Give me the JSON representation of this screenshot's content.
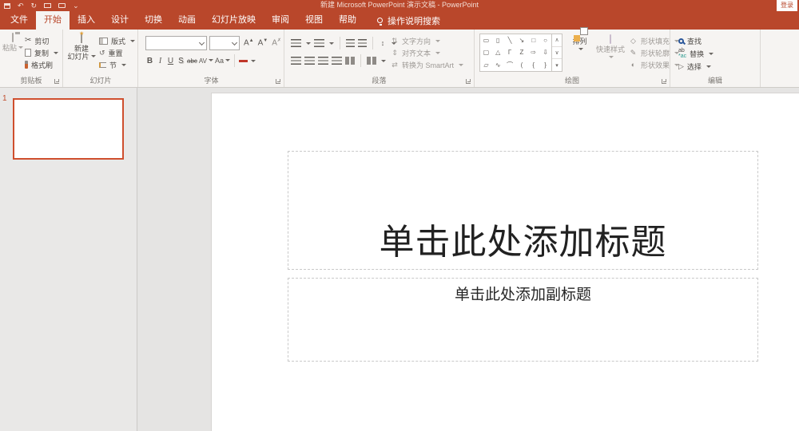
{
  "titlebar": {
    "title": "新建 Microsoft PowerPoint 演示文稿 - PowerPoint",
    "sign_in": "登录"
  },
  "tabs": {
    "items": [
      {
        "label": "文件"
      },
      {
        "label": "开始",
        "active": true
      },
      {
        "label": "插入"
      },
      {
        "label": "设计"
      },
      {
        "label": "切换"
      },
      {
        "label": "动画"
      },
      {
        "label": "幻灯片放映"
      },
      {
        "label": "审阅"
      },
      {
        "label": "视图"
      },
      {
        "label": "帮助"
      }
    ],
    "tell_me": "操作说明搜索"
  },
  "ribbon": {
    "clipboard": {
      "label": "剪贴板",
      "paste": "粘贴",
      "cut": "剪切",
      "copy": "复制",
      "format_painter": "格式刷"
    },
    "slides": {
      "label": "幻灯片",
      "new_slide_line1": "新建",
      "new_slide_line2": "幻灯片",
      "layout": "版式",
      "reset": "重置",
      "section": "节"
    },
    "font": {
      "label": "字体",
      "bold": "B",
      "italic": "I",
      "underline": "U",
      "shadow": "S",
      "strikethrough": "abc",
      "char_spacing": "AV",
      "change_case": "Aa",
      "font_color": "A",
      "grow_font": "A",
      "shrink_font": "A",
      "clear_format": "A"
    },
    "paragraph": {
      "label": "段落",
      "text_direction": "文字方向",
      "align_text": "对齐文本",
      "smartart": "转换为 SmartArt"
    },
    "drawing": {
      "label": "绘图",
      "arrange": "排列",
      "quick_styles": "快速样式",
      "shape_fill": "形状填充",
      "shape_outline": "形状轮廓",
      "shape_effects": "形状效果",
      "shapes": [
        "▭",
        "▯",
        "╲",
        "↘",
        "□",
        "○",
        "▢",
        "△",
        "Γ",
        "Z",
        "⇨",
        "⇩",
        "▱",
        "∿",
        "⌒",
        "(",
        "{",
        "}"
      ],
      "scroll": [
        "∧",
        "∨",
        "▾"
      ]
    },
    "editing": {
      "label": "编辑",
      "find": "查找",
      "replace": "替换",
      "select": "选择"
    }
  },
  "slides_panel": {
    "slide_number": "1"
  },
  "slide": {
    "title_placeholder": "单击此处添加标题",
    "subtitle_placeholder": "单击此处添加副标题"
  },
  "colors": {
    "accent_red": "#B9472B",
    "selection_orange": "#CF4F2E"
  }
}
